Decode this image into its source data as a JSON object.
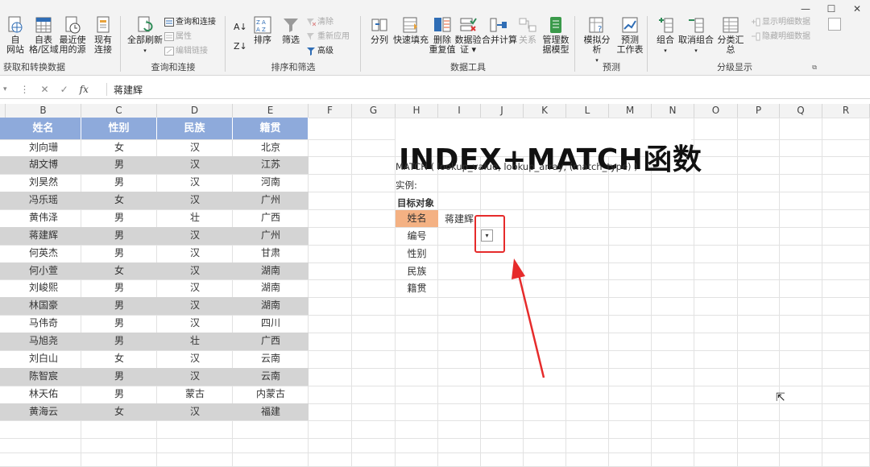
{
  "window": {
    "minimize": "—",
    "maximize": "☐",
    "close": "✕"
  },
  "ribbon": {
    "get_transform": {
      "label": "获取和转换数据",
      "buttons": [
        {
          "label": "自\n网站",
          "icon": "web-icon"
        },
        {
          "label": "自表\n格/区域",
          "icon": "table-icon"
        },
        {
          "label": "最近使\n用的源",
          "icon": "recent-sources-icon"
        },
        {
          "label": "现有\n连接",
          "icon": "existing-connections-icon"
        }
      ]
    },
    "queries": {
      "label": "查询和连接",
      "refresh_all": "全部刷新",
      "queries_connections": "查询和连接",
      "properties": "属性",
      "edit_links": "编辑链接"
    },
    "sort_filter": {
      "label": "排序和筛选",
      "sort": "排序",
      "filter": "筛选",
      "clear": "清除",
      "reapply": "重新应用",
      "advanced": "高级"
    },
    "data_tools": {
      "label": "数据工具",
      "buttons": [
        {
          "label": "分列",
          "icon": "text-to-columns-icon"
        },
        {
          "label": "快速填充",
          "icon": "flash-fill-icon"
        },
        {
          "label": "删除\n重复值",
          "icon": "remove-duplicates-icon"
        },
        {
          "label": "数据验\n证 ▾",
          "icon": "data-validation-icon"
        },
        {
          "label": "合并计算",
          "icon": "consolidate-icon"
        },
        {
          "label": "关系",
          "icon": "relationships-icon"
        },
        {
          "label": "管理数\n据模型",
          "icon": "data-model-icon"
        }
      ]
    },
    "forecast": {
      "label": "预测",
      "what_if": "模拟分析",
      "forecast_sheet": "预测\n工作表"
    },
    "outline": {
      "label": "分级显示",
      "group": "组合",
      "ungroup": "取消组合",
      "subtotal": "分类汇总",
      "show_detail": "显示明细数据",
      "hide_detail": "隐藏明细数据"
    }
  },
  "formula_bar": {
    "cancel": "✕",
    "enter": "✓",
    "fx": "fx",
    "value": "蒋建辉"
  },
  "columns": [
    "B",
    "C",
    "D",
    "E",
    "F",
    "G",
    "H",
    "I",
    "J",
    "K",
    "L",
    "M",
    "N",
    "O",
    "P",
    "Q",
    "R"
  ],
  "table": {
    "headers": [
      "姓名",
      "性别",
      "民族",
      "籍贯"
    ],
    "rows": [
      [
        "刘向珊",
        "女",
        "汉",
        "北京"
      ],
      [
        "胡文博",
        "男",
        "汉",
        "江苏"
      ],
      [
        "刘昊然",
        "男",
        "汉",
        "河南"
      ],
      [
        "冯乐瑶",
        "女",
        "汉",
        "广州"
      ],
      [
        "黄伟泽",
        "男",
        "壮",
        "广西"
      ],
      [
        "蒋建辉",
        "男",
        "汉",
        "广州"
      ],
      [
        "何英杰",
        "男",
        "汉",
        "甘肃"
      ],
      [
        "何小萱",
        "女",
        "汉",
        "湖南"
      ],
      [
        "刘峻熙",
        "男",
        "汉",
        "湖南"
      ],
      [
        "林国豪",
        "男",
        "汉",
        "湖南"
      ],
      [
        "马伟奇",
        "男",
        "汉",
        "四川"
      ],
      [
        "马旭尧",
        "男",
        "壮",
        "广西"
      ],
      [
        "刘白山",
        "女",
        "汉",
        "云南"
      ],
      [
        "陈智宸",
        "男",
        "汉",
        "云南"
      ],
      [
        "林天佑",
        "男",
        "蒙古",
        "内蒙古"
      ],
      [
        "黄海云",
        "女",
        "汉",
        "福建"
      ]
    ]
  },
  "demo": {
    "title": "INDEX+MATCH函数",
    "syntax": "MATCH ( lookup_value, lookup_array, (match_type) )",
    "example": "实例:",
    "target": "目标对象",
    "name_label": "姓名",
    "name_value": "蒋建辉",
    "fields": [
      "编号",
      "性别",
      "民族",
      "籍贯"
    ],
    "dropdown_icon": "chevron-down-icon"
  },
  "colors": {
    "header_blue": "#8eaadb",
    "stripe_gray": "#d4d4d4",
    "orange": "#f4b183",
    "highlight_red": "#e62b2b"
  }
}
